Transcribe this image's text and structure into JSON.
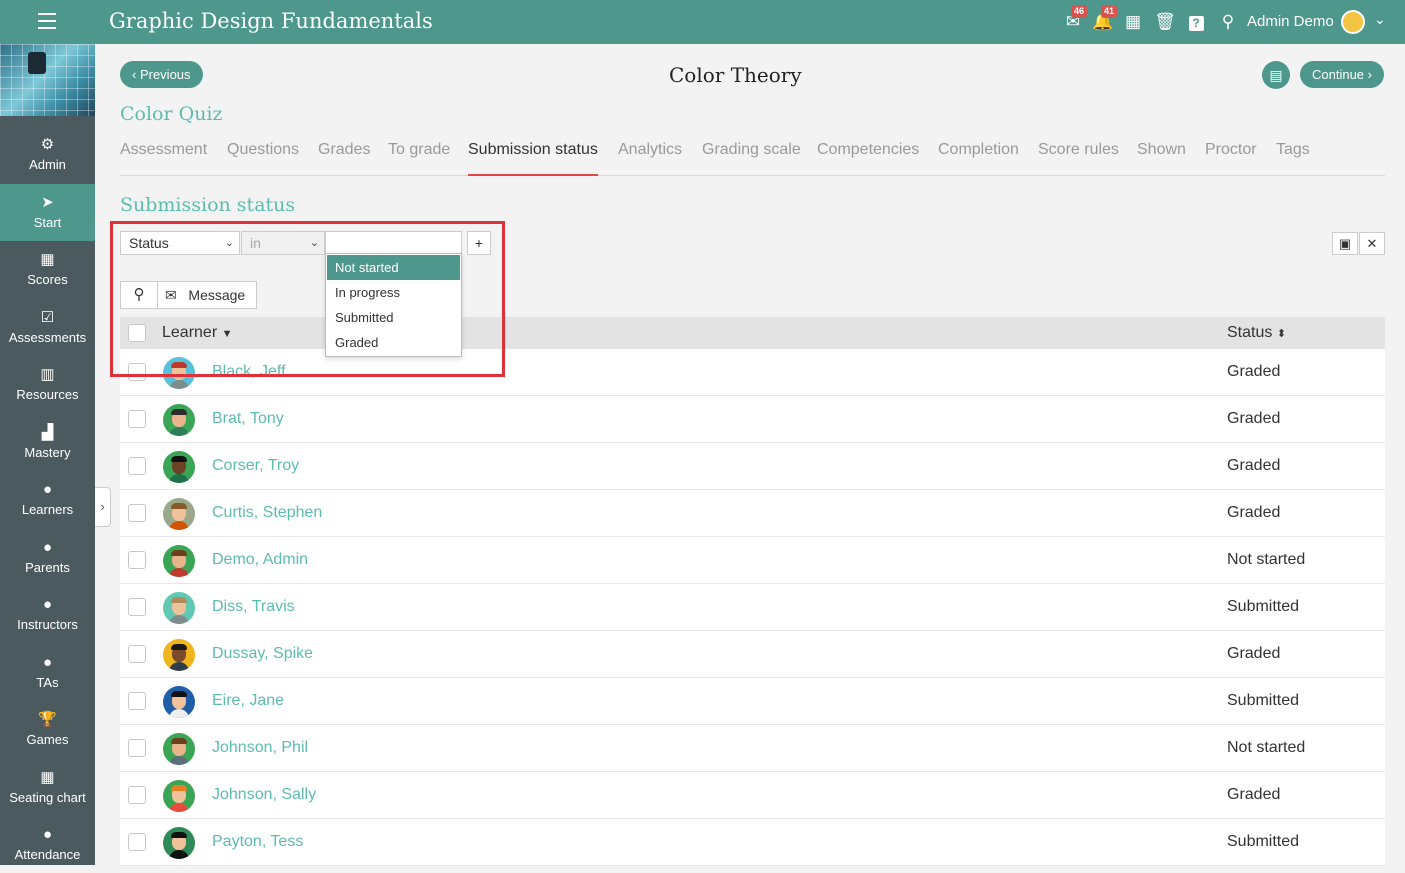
{
  "app": {
    "title": "Graphic Design Fundamentals",
    "user_name": "Admin Demo",
    "mail_count": "46",
    "notif_count": "41"
  },
  "sidebar": {
    "items": [
      {
        "label": "Admin",
        "icon": "gear-icon",
        "glyph": "⚙"
      },
      {
        "label": "Start",
        "icon": "navigation-arrow-icon",
        "glyph": "➤"
      },
      {
        "label": "Scores",
        "icon": "grid-icon",
        "glyph": "▦"
      },
      {
        "label": "Assessments",
        "icon": "checkbox-icon",
        "glyph": "☑"
      },
      {
        "label": "Resources",
        "icon": "books-icon",
        "glyph": "▥"
      },
      {
        "label": "Mastery",
        "icon": "bar-chart-icon",
        "glyph": "▟"
      },
      {
        "label": "Learners",
        "icon": "person-icon",
        "glyph": "●"
      },
      {
        "label": "Parents",
        "icon": "person-icon",
        "glyph": "●"
      },
      {
        "label": "Instructors",
        "icon": "instructor-icon",
        "glyph": "●"
      },
      {
        "label": "TAs",
        "icon": "ta-icon",
        "glyph": "●"
      },
      {
        "label": "Games",
        "icon": "trophy-icon",
        "glyph": "🏆"
      },
      {
        "label": "Seating chart",
        "icon": "seating-icon",
        "glyph": "▦"
      },
      {
        "label": "Attendance",
        "icon": "group-icon",
        "glyph": "●"
      }
    ],
    "active_index": 1
  },
  "nav": {
    "previous": "Previous",
    "continue": "Continue",
    "page_title": "Color Theory"
  },
  "quiz_name": "Color Quiz",
  "tabs": [
    "Assessment",
    "Questions",
    "Grades",
    "To grade",
    "Submission status",
    "Analytics",
    "Grading scale",
    "Competencies",
    "Completion",
    "Score rules",
    "Shown",
    "Proctor",
    "Tags"
  ],
  "active_tab": "Submission status",
  "section_title": "Submission status",
  "filter": {
    "field": "Status",
    "operator": "in",
    "value": "",
    "plus": "+"
  },
  "dropdown_options": [
    "Not started",
    "In progress",
    "Submitted",
    "Graded"
  ],
  "dropdown_selected": "Not started",
  "toolbar": {
    "message": "Message"
  },
  "table": {
    "headers": {
      "learner": "Learner",
      "status": "Status"
    },
    "rows": [
      {
        "name": "Black, Jeff",
        "status": "Graded"
      },
      {
        "name": "Brat, Tony",
        "status": "Graded"
      },
      {
        "name": "Corser, Troy",
        "status": "Graded"
      },
      {
        "name": "Curtis, Stephen",
        "status": "Graded"
      },
      {
        "name": "Demo, Admin",
        "status": "Not started"
      },
      {
        "name": "Diss, Travis",
        "status": "Submitted"
      },
      {
        "name": "Dussay, Spike",
        "status": "Graded"
      },
      {
        "name": "Eire, Jane",
        "status": "Submitted"
      },
      {
        "name": "Johnson, Phil",
        "status": "Not started"
      },
      {
        "name": "Johnson, Sally",
        "status": "Graded"
      },
      {
        "name": "Payton, Tess",
        "status": "Submitted"
      }
    ]
  },
  "colors": {
    "primary": "#4e978c",
    "link": "#5dbcb0",
    "highlight": "#e0303a",
    "sidebar": "#4b5a5f"
  }
}
